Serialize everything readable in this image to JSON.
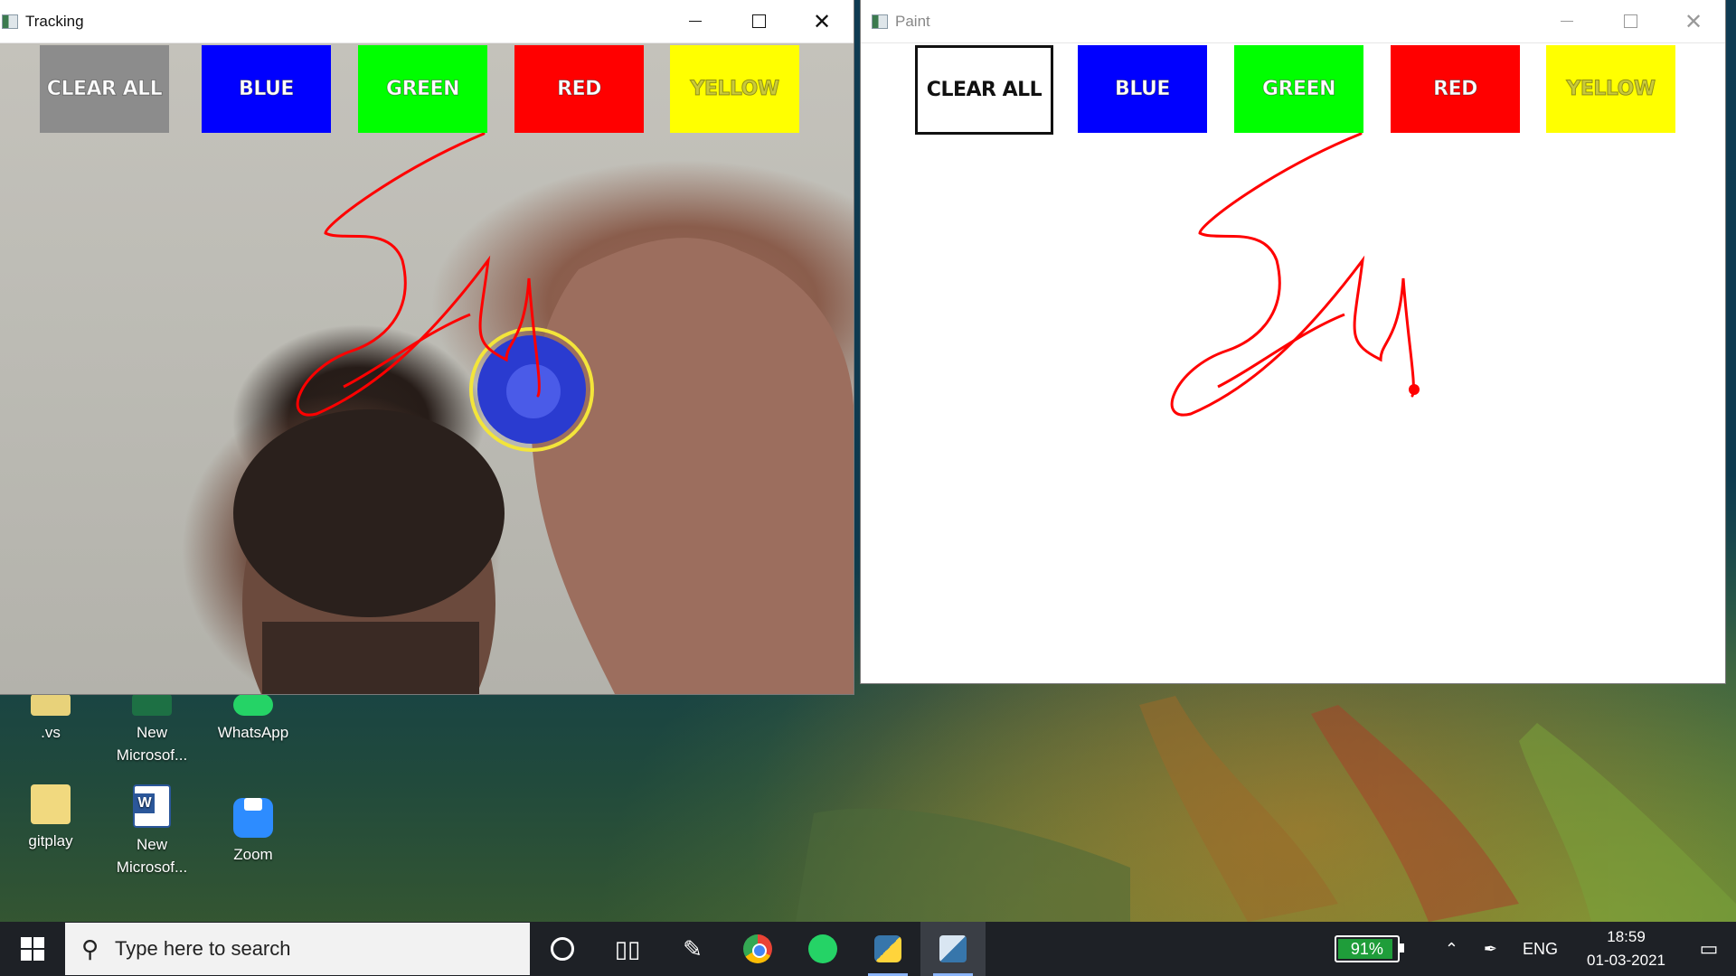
{
  "tracking_window": {
    "title": "Tracking",
    "buttons": [
      {
        "label": "CLEAR ALL",
        "color": "#8c8c8c"
      },
      {
        "label": "BLUE",
        "color": "#0000ff"
      },
      {
        "label": "GREEN",
        "color": "#00ff00"
      },
      {
        "label": "RED",
        "color": "#ff0000"
      },
      {
        "label": "YELLOW",
        "color": "#ffff00"
      }
    ]
  },
  "paint_window": {
    "title": "Paint",
    "buttons": [
      {
        "label": "CLEAR ALL",
        "color": "#ffffff"
      },
      {
        "label": "BLUE",
        "color": "#0000ff"
      },
      {
        "label": "GREEN",
        "color": "#00ff00"
      },
      {
        "label": "RED",
        "color": "#ff0000"
      },
      {
        "label": "YELLOW",
        "color": "#ffff00"
      }
    ],
    "stroke_color": "#ff0000"
  },
  "desktop_icons": [
    {
      "label": ".vs",
      "icon": "folder-icon"
    },
    {
      "label": "New Microsof...",
      "icon": "excel-icon"
    },
    {
      "label": "WhatsApp",
      "icon": "whatsapp-icon"
    },
    {
      "label": "gitplay",
      "icon": "folder-icon"
    },
    {
      "label": "New Microsof...",
      "icon": "word-icon"
    },
    {
      "label": "Zoom",
      "icon": "zoom-icon"
    }
  ],
  "taskbar": {
    "search_placeholder": "Type here to search",
    "battery": "91%",
    "language": "ENG",
    "time": "18:59",
    "date": "01-03-2021"
  }
}
